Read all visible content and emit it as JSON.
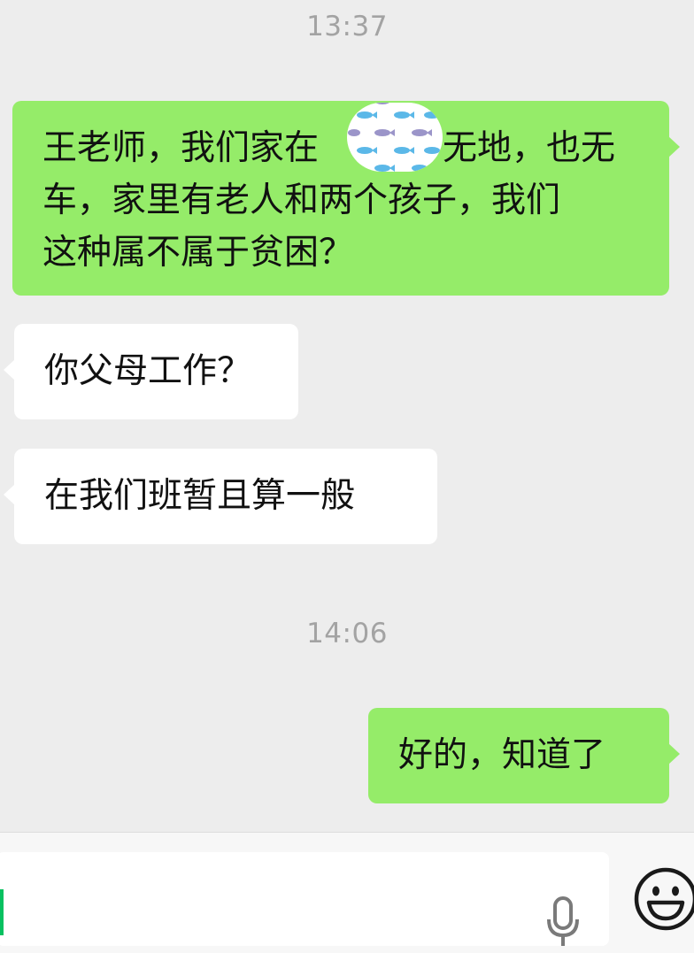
{
  "chat": {
    "timestamps": [
      "13:37",
      "14:06"
    ],
    "messages": [
      {
        "side": "right",
        "lines": [
          "王老师，我们家在",
          "无地，也无",
          "车，家里有老人和两个孩子，我们",
          "这种属不属于贫困？"
        ]
      },
      {
        "side": "left",
        "text": "你父母工作？"
      },
      {
        "side": "left",
        "text": "在我们班暂且算一般"
      },
      {
        "side": "right",
        "text": "好的，知道了"
      }
    ]
  },
  "input_bar": {
    "value": "",
    "icons": [
      "microphone-icon",
      "emoji-icon"
    ]
  },
  "colors": {
    "background": "#ededed",
    "sent_bubble": "#95ec69",
    "received_bubble": "#ffffff",
    "timestamp": "#a3a3a3",
    "caret": "#07c160"
  }
}
